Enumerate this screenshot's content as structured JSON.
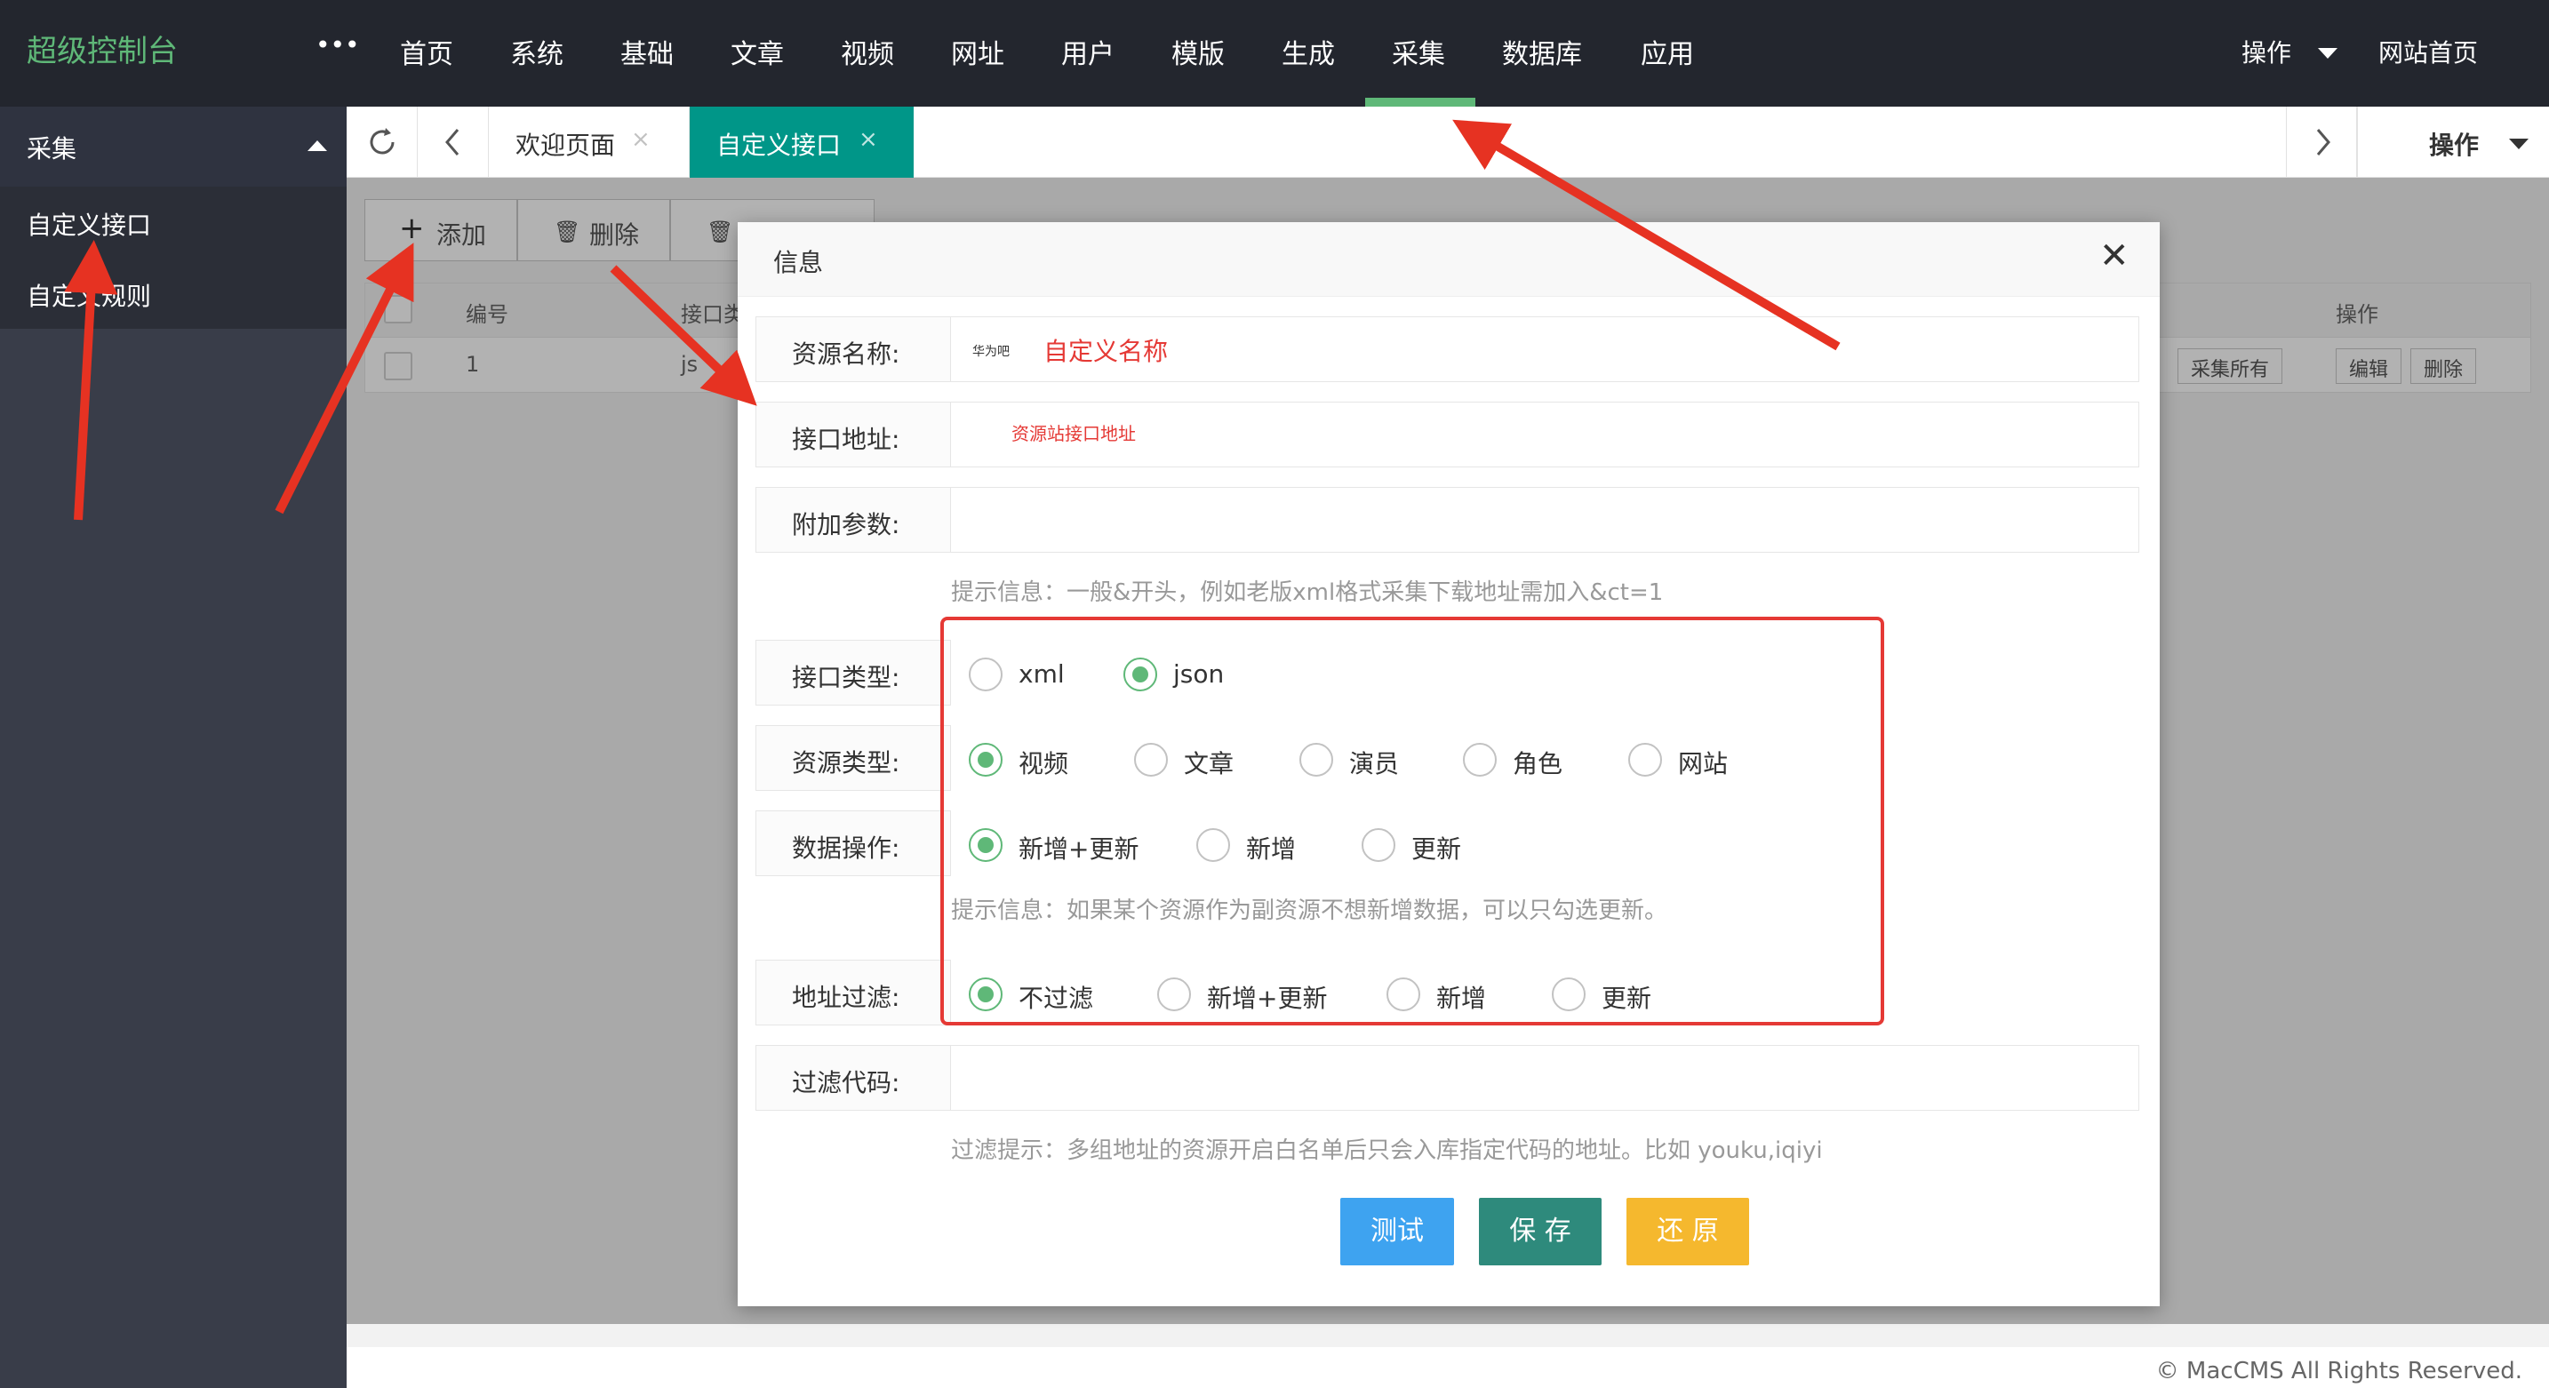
{
  "header": {
    "logo": "超级控制台",
    "more": "•••",
    "nav": [
      "首页",
      "系统",
      "基础",
      "文章",
      "视频",
      "网址",
      "用户",
      "模版",
      "生成",
      "采集",
      "数据库",
      "应用"
    ],
    "active_nav": "采集",
    "ops_label": "操作",
    "home_link": "网站首页"
  },
  "sidebar": {
    "section": "采集",
    "items": [
      {
        "label": "自定义接口"
      },
      {
        "label": "自定义规则"
      }
    ]
  },
  "tabs": {
    "welcome": "欢迎页面",
    "active": "自定义接口",
    "close": "×",
    "ops_label": "操作"
  },
  "toolbar": {
    "add": "添加",
    "delete": "删除"
  },
  "table": {
    "headers": [
      "编号",
      "接口类",
      "操作"
    ],
    "row": {
      "id": "1",
      "type": "js",
      "collect_all": "采集所有",
      "edit": "编辑",
      "delete": "删除"
    }
  },
  "modal": {
    "title": "信息",
    "close": "✕",
    "fields": {
      "name_label": "资源名称:",
      "name_value": "华为吧",
      "url_label": "接口地址:",
      "params_label": "附加参数:",
      "params_hint": "提示信息：一般&开头，例如老版xml格式采集下载地址需加入&ct=1",
      "type_label": "接口类型:",
      "type_options": [
        "xml",
        "json"
      ],
      "res_label": "资源类型:",
      "res_options": [
        "视频",
        "文章",
        "演员",
        "角色",
        "网站"
      ],
      "op_label": "数据操作:",
      "op_options": [
        "新增+更新",
        "新增",
        "更新"
      ],
      "op_hint": "提示信息：如果某个资源作为副资源不想新增数据，可以只勾选更新。",
      "filter_label": "地址过滤:",
      "filter_options": [
        "不过滤",
        "新增+更新",
        "新增",
        "更新"
      ],
      "code_label": "过滤代码:",
      "code_hint": "过滤提示：多组地址的资源开启白名单后只会入库指定代码的地址。比如 youku,iqiyi"
    },
    "buttons": {
      "test": "测试",
      "save": "保 存",
      "reset": "还 原"
    }
  },
  "annotations": {
    "name_note": "自定义名称",
    "url_note": "资源站接口地址"
  },
  "footer": "© MacCMS All Rights Reserved.",
  "colors": {
    "accent": "#5fb878",
    "teal": "#009688",
    "header_bg": "#23262e",
    "sidebar_bg": "#393d49",
    "annotation_red": "#e53935",
    "test_btn": "#3ea3f0",
    "save_btn": "#2e8a7c",
    "reset_btn": "#f5b82e"
  }
}
